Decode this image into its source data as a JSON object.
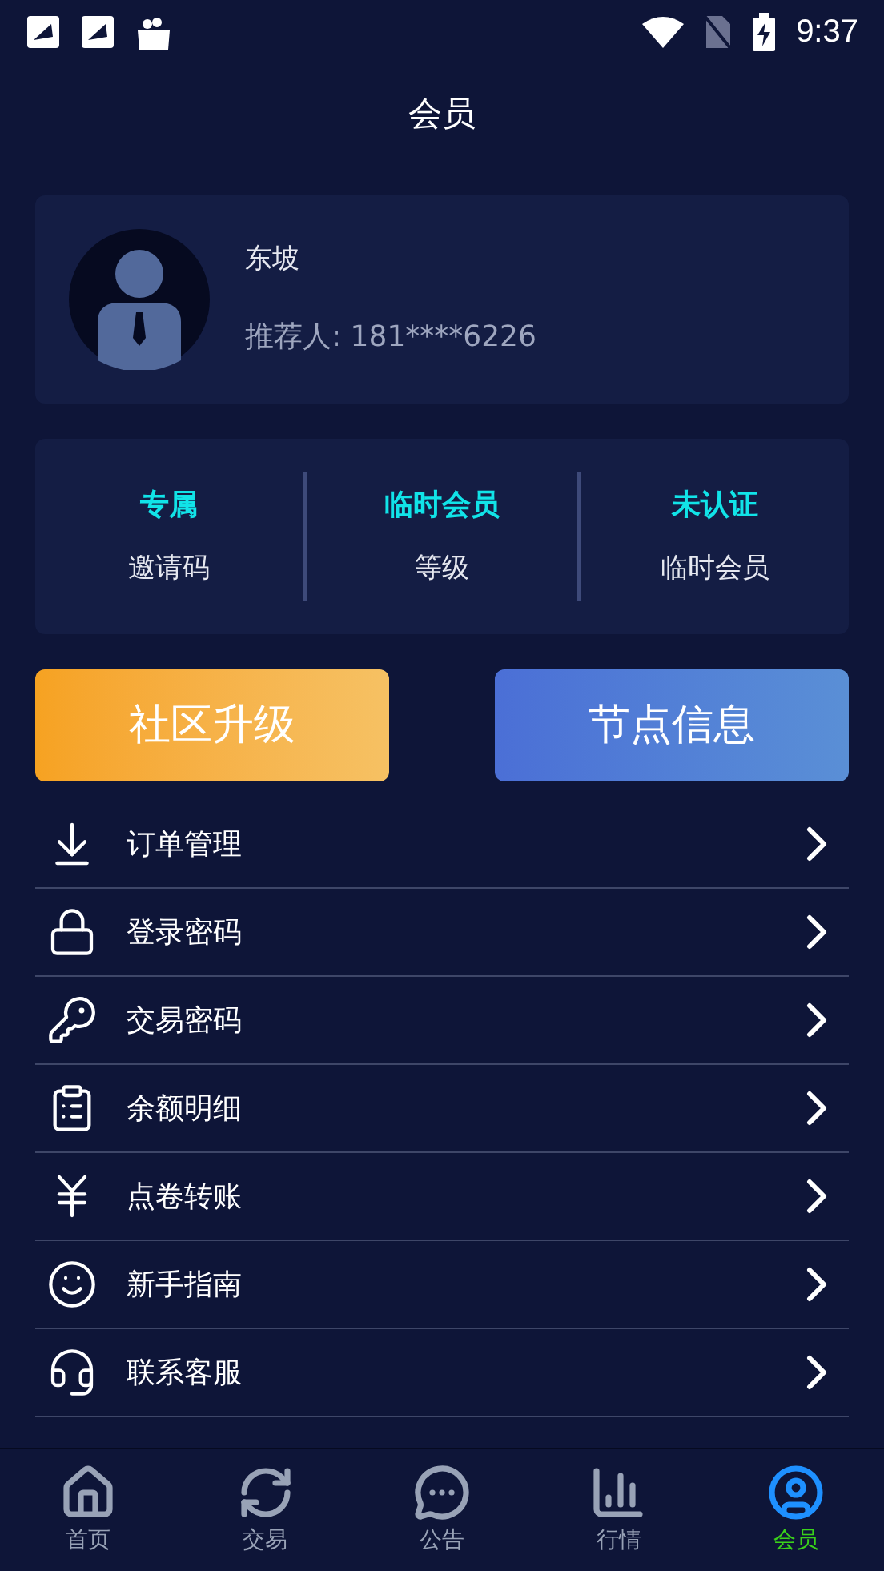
{
  "status_bar": {
    "time": "9:37"
  },
  "title": "会员",
  "profile": {
    "name": "东坡",
    "referrer": "推荐人: 181****6226"
  },
  "stats": [
    {
      "value": "专属",
      "label": "邀请码"
    },
    {
      "value": "临时会员",
      "label": "等级"
    },
    {
      "value": "未认证",
      "label": "临时会员"
    }
  ],
  "buttons": [
    {
      "label": "社区升级",
      "kind": "warm"
    },
    {
      "label": "节点信息",
      "kind": "cool"
    }
  ],
  "menu": [
    {
      "label": "订单管理"
    },
    {
      "label": "登录密码"
    },
    {
      "label": "交易密码"
    },
    {
      "label": "余额明细"
    },
    {
      "label": "点卷转账"
    },
    {
      "label": "新手指南"
    },
    {
      "label": "联系客服"
    }
  ],
  "tabs": [
    {
      "label": "首页",
      "selected": false
    },
    {
      "label": "交易",
      "selected": false
    },
    {
      "label": "公告",
      "selected": false
    },
    {
      "label": "行情",
      "selected": false
    },
    {
      "label": "会员",
      "selected": true
    }
  ]
}
